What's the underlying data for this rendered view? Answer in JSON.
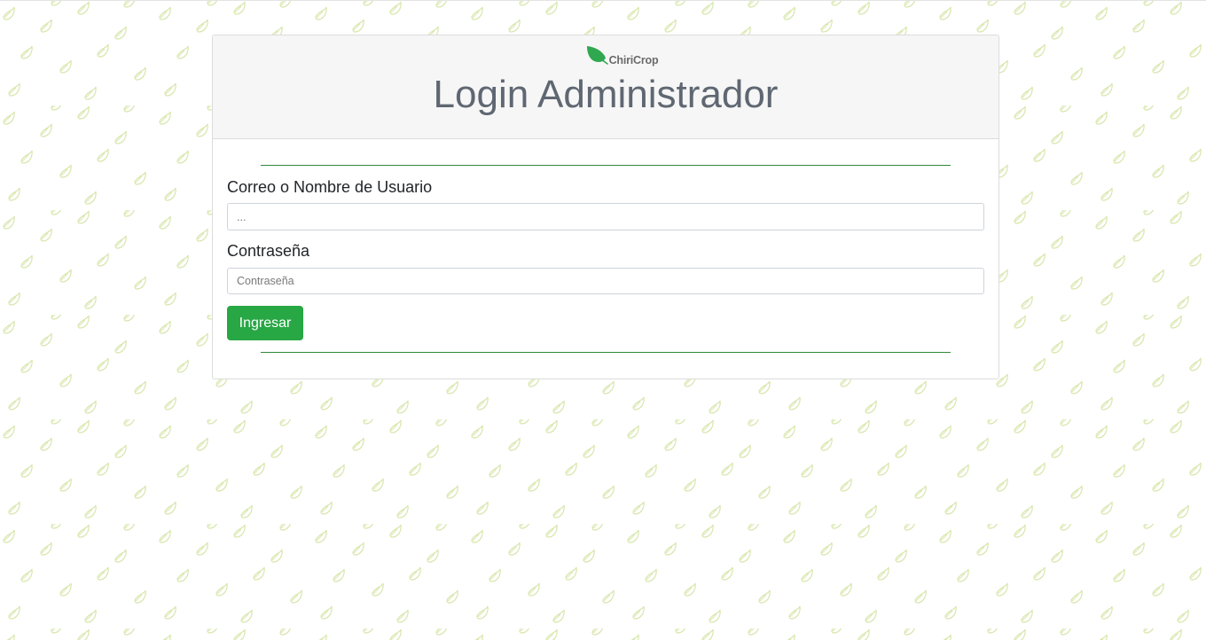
{
  "brand": {
    "name": "ChiriCrop",
    "icon": "leaf-icon",
    "color": "#2fa84f"
  },
  "login": {
    "title": "Login Administrador",
    "username": {
      "label": "Correo o Nombre de Usuario",
      "placeholder": "...",
      "value": ""
    },
    "password": {
      "label": "Contraseña",
      "placeholder": "Contraseña",
      "value": ""
    },
    "submit_label": "Ingresar"
  },
  "theme": {
    "accent": "#28a745",
    "divider": "#2f8a3a",
    "header_bg": "#f6f6f6",
    "title_color": "#5f6772",
    "pattern_leaf": "#d8e8b0",
    "pattern_icon": "leaf-icon"
  }
}
